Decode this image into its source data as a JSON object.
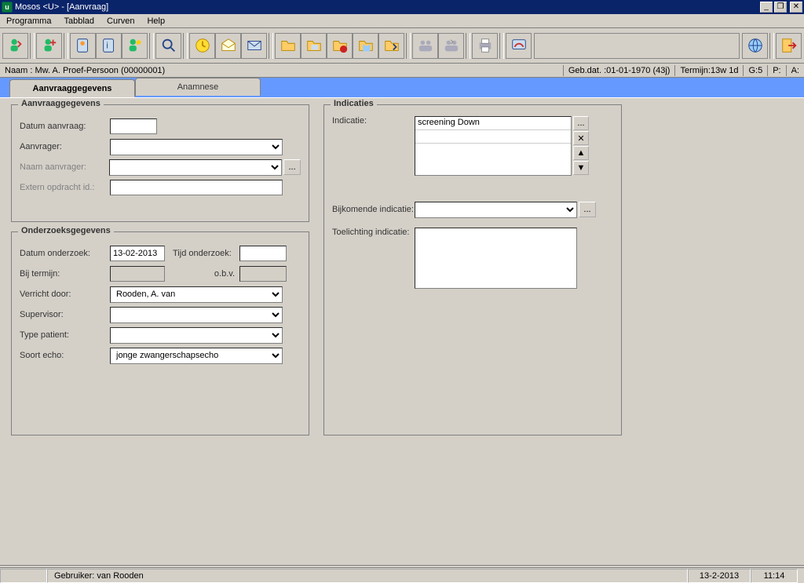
{
  "title": "Mosos <U> - [Aanvraag]",
  "menu": {
    "items": [
      "Programma",
      "Tabblad",
      "Curven",
      "Help"
    ]
  },
  "infobar": {
    "left": "Naam : Mw. A. Proef-Persoon (00000001)",
    "gebdat": "Geb.dat. :01-01-1970 (43j)",
    "termijn": "Termijn:13w 1d",
    "g": "G:5",
    "p": "P:",
    "a": "A:"
  },
  "tabs": {
    "t1": "Aanvraaggegevens",
    "t2": "Anamnese"
  },
  "groups": {
    "aanvraag": {
      "legend": "Aanvraaggegevens",
      "datum_aanvraag_lbl": "Datum aanvraag:",
      "datum_aanvraag_val": "",
      "aanvrager_lbl": "Aanvrager:",
      "aanvrager_val": "",
      "naam_aanvrager_lbl": "Naam aanvrager:",
      "naam_aanvrager_val": "",
      "extern_lbl": "Extern opdracht id.:",
      "extern_val": ""
    },
    "onderzoek": {
      "legend": "Onderzoeksgegevens",
      "datum_lbl": "Datum onderzoek:",
      "datum_val": "13-02-2013",
      "tijd_lbl": "Tijd onderzoek:",
      "tijd_val": "",
      "bijtermijn_lbl": "Bij termijn:",
      "bijtermijn_val": "",
      "obv_lbl": "o.b.v.",
      "obv_val": "",
      "verricht_lbl": "Verricht door:",
      "verricht_val": "Rooden, A. van",
      "supervisor_lbl": "Supervisor:",
      "supervisor_val": "",
      "typepatient_lbl": "Type patient:",
      "typepatient_val": "",
      "soortecho_lbl": "Soort echo:",
      "soortecho_val": "jonge zwangerschapsecho"
    },
    "indicaties": {
      "legend": "Indicaties",
      "indicatie_lbl": "Indicatie:",
      "indicatie_item1": "screening Down",
      "bijkomende_lbl": "Bijkomende indicatie:",
      "bijkomende_val": "",
      "toelichting_lbl": "Toelichting indicatie:",
      "toelichting_val": ""
    }
  },
  "status": {
    "user_lbl": "Gebruiker: van Rooden",
    "date": "13-2-2013",
    "time": "11:14"
  },
  "icons": {
    "ellipsis": "...",
    "close": "✕",
    "up": "▲",
    "down": "▼"
  }
}
